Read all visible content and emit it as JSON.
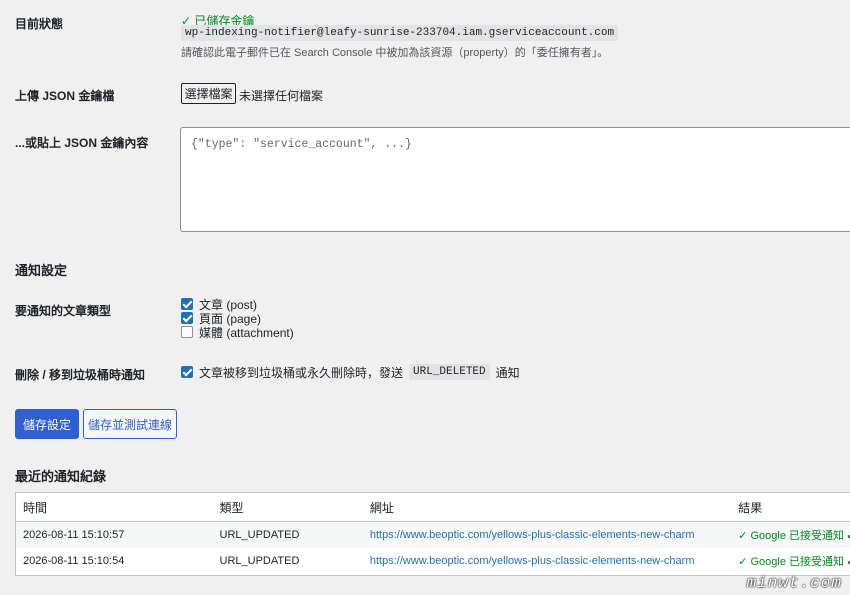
{
  "status": {
    "label": "目前狀態",
    "saved_text": "已儲存金鑰",
    "email": "wp-indexing-notifier@leafy-sunrise-233704.iam.gserviceaccount.com",
    "note": "請確認此電子郵件已在 Search Console 中被加為該資源（property）的「委任擁有者」。"
  },
  "upload": {
    "label": "上傳 JSON 金鑰檔",
    "choose_button": "選擇檔案",
    "no_file_text": "未選擇任何檔案"
  },
  "paste": {
    "label": "...或貼上 JSON 金鑰內容",
    "placeholder": "{\"type\": \"service_account\", ...}"
  },
  "notify": {
    "section_title": "通知設定",
    "post_types_label": "要通知的文章類型",
    "post_types": [
      {
        "label": "文章 (post)",
        "checked": true
      },
      {
        "label": "頁面 (page)",
        "checked": true
      },
      {
        "label": "媒體 (attachment)",
        "checked": false
      }
    ],
    "trash_label": "刪除 / 移到垃圾桶時通知",
    "trash_text_before": "文章被移到垃圾桶或永久刪除時，發送",
    "trash_code": "URL_DELETED",
    "trash_text_after": "通知",
    "trash_checked": true
  },
  "buttons": {
    "save": "儲存設定",
    "save_test": "儲存並測試連線"
  },
  "log": {
    "title": "最近的通知紀錄",
    "columns": [
      "時間",
      "類型",
      "網址",
      "結果"
    ],
    "rows": [
      {
        "time": "2026-08-11 15:10:57",
        "type": "URL_UPDATED",
        "url": "https://www.beoptic.com/yellows-plus-classic-elements-new-charm",
        "result": "Google 已接受通知"
      },
      {
        "time": "2026-08-11 15:10:54",
        "type": "URL_UPDATED",
        "url": "https://www.beoptic.com/yellows-plus-classic-elements-new-charm",
        "result": "Google 已接受通知"
      }
    ]
  },
  "watermark": "minwt.com",
  "colors": {
    "primary": "#2f5fd0",
    "success": "#008a20",
    "link": "#2271b1"
  }
}
